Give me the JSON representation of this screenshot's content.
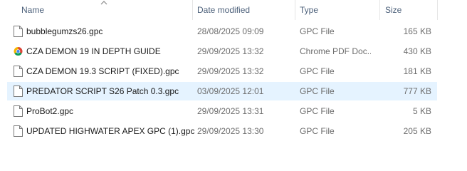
{
  "columns": {
    "name": "Name",
    "date": "Date modified",
    "type": "Type",
    "size": "Size"
  },
  "files": [
    {
      "name": "bubblegumzs26.gpc",
      "date": "28/08/2025 09:09",
      "type": "GPC File",
      "size": "165 KB",
      "icon": "document-icon"
    },
    {
      "name": "CZA DEMON 19 IN DEPTH GUIDE",
      "date": "29/09/2025 13:32",
      "type": "Chrome PDF Doc...",
      "size": "430 KB",
      "icon": "chrome-pdf-icon"
    },
    {
      "name": "CZA DEMON 19.3 SCRIPT (FIXED).gpc",
      "date": "29/09/2025 13:32",
      "type": "GPC File",
      "size": "181 KB",
      "icon": "document-icon"
    },
    {
      "name": "PREDATOR SCRIPT S26 Patch 0.3.gpc",
      "date": "03/09/2025 12:01",
      "type": "GPC File",
      "size": "777 KB",
      "icon": "document-icon",
      "selected": true
    },
    {
      "name": "ProBot2.gpc",
      "date": "29/09/2025 13:31",
      "type": "GPC File",
      "size": "5 KB",
      "icon": "document-icon"
    },
    {
      "name": "UPDATED HIGHWATER APEX GPC (1).gpc",
      "date": "29/09/2025 13:30",
      "type": "GPC File",
      "size": "205 KB",
      "icon": "document-icon"
    }
  ],
  "colors": {
    "selected_row": "#e5f3ff",
    "header_text": "#4c607a"
  }
}
